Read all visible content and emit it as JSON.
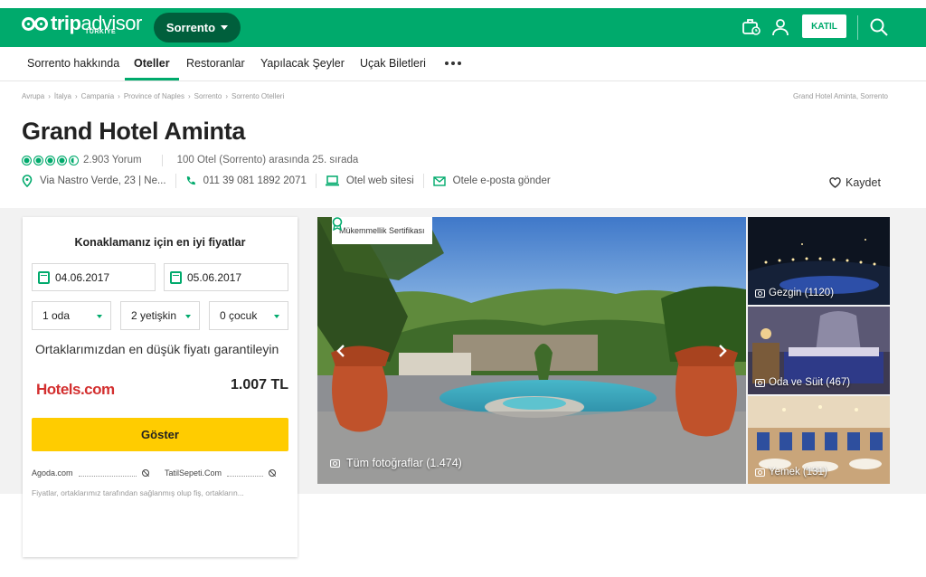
{
  "header": {
    "brand_left": "trip",
    "brand_right": "advisor",
    "brand_sub": "TÜRKİYE",
    "location": "Sorrento",
    "join_label": "KATIL",
    "brand_color": "#00aa6c"
  },
  "nav": {
    "items": [
      {
        "label": "Sorrento hakkında",
        "active": false
      },
      {
        "label": "Oteller",
        "active": true
      },
      {
        "label": "Restoranlar",
        "active": false
      },
      {
        "label": "Yapılacak Şeyler",
        "active": false
      },
      {
        "label": "Uçak Biletleri",
        "active": false
      }
    ],
    "more_icon": "more-dots-icon"
  },
  "breadcrumb": {
    "items": [
      "Avrupa",
      "İtalya",
      "Campania",
      "Province of Naples",
      "Sorrento",
      "Sorrento Otelleri"
    ],
    "right": "Grand Hotel Aminta, Sorrento"
  },
  "hotel": {
    "name": "Grand Hotel Aminta",
    "rating": 4.5,
    "reviews": "2.903 Yorum",
    "ranking": "100 Otel (Sorrento) arasında 25. sırada",
    "address": "Via Nastro Verde, 23 | Ne...",
    "phone": "011 39 081 1892 2071",
    "website_label": "Otel web sitesi",
    "email_label": "Otele e-posta gönder",
    "save_label": "Kaydet"
  },
  "booking": {
    "title": "Konaklamanız için en iyi fiyatlar",
    "checkin": "04.06.2017",
    "checkout": "05.06.2017",
    "rooms": "1 oda",
    "adults": "2 yetişkin",
    "children": "0 çocuk",
    "guarantee": "Ortaklarımızdan en düşük fiyatı garantileyin",
    "provider": "Hotels.com",
    "price": "1.007 TL",
    "show_label": "Göster",
    "partners": [
      "Agoda.com",
      "TatilSepeti.Com"
    ],
    "disclaimer": "Fiyatlar, ortaklarımız tarafından sağlanmış olup fiş, ortakların..."
  },
  "gallery": {
    "certificate": "Mükemmellik Sertifikası",
    "all_photos": "Tüm fotoğraflar (1.474)",
    "thumbs": [
      {
        "label": "Gezgin (1120)"
      },
      {
        "label": "Oda ve Süit (467)"
      },
      {
        "label": "Yemek (131)"
      }
    ]
  }
}
